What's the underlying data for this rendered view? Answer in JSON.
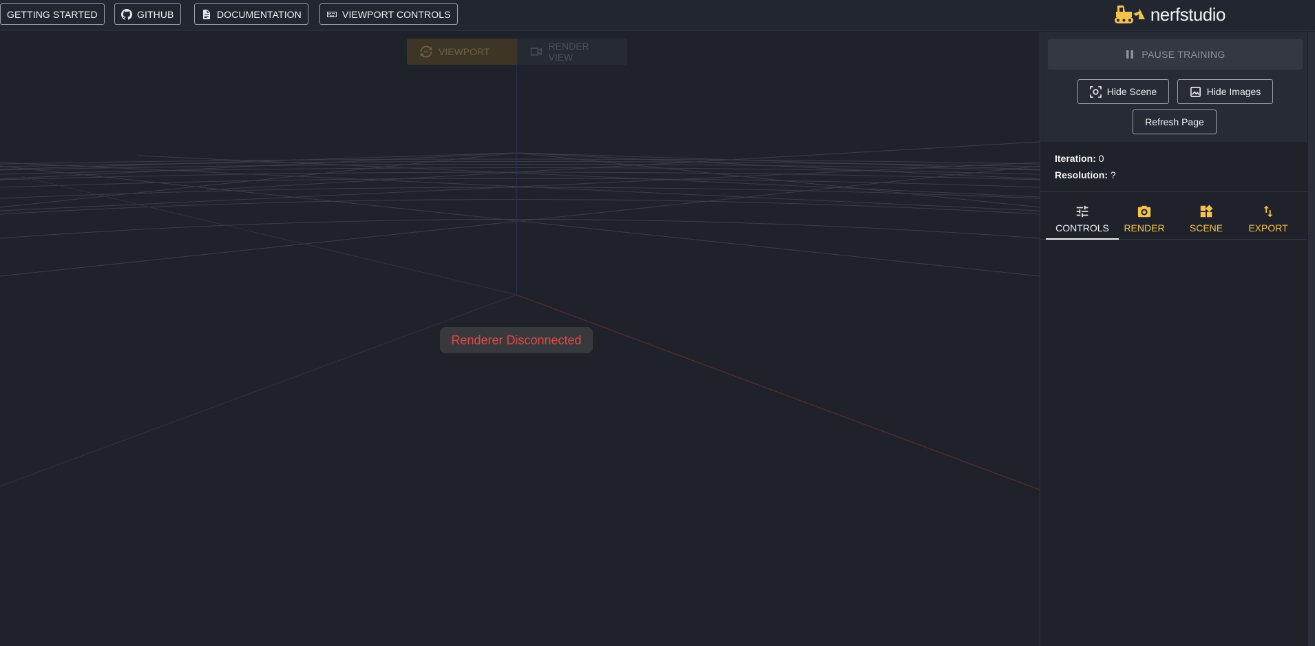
{
  "topbar": {
    "buttons": [
      {
        "label": "GETTING STARTED",
        "icon": "none"
      },
      {
        "label": "GITHUB",
        "icon": "github-icon"
      },
      {
        "label": "DOCUMENTATION",
        "icon": "document-icon"
      },
      {
        "label": "VIEWPORT CONTROLS",
        "icon": "keyboard-icon"
      }
    ],
    "logo_text": "nerfstudio",
    "logo_icon": "bulldozer-icon"
  },
  "viewport": {
    "toggle": {
      "viewport_label": "VIEWPORT",
      "render_view_label": "RENDER VIEW"
    },
    "status": "Renderer Disconnected"
  },
  "panel": {
    "pause_label": "PAUSE TRAINING",
    "hide_scene_label": "Hide Scene",
    "hide_images_label": "Hide Images",
    "refresh_label": "Refresh Page",
    "stats": {
      "iteration_label": "Iteration:",
      "iteration_value": "0",
      "resolution_label": "Resolution:",
      "resolution_value": "?"
    },
    "tabs": [
      {
        "label": "CONTROLS",
        "icon": "sliders-icon",
        "active": true
      },
      {
        "label": "RENDER",
        "icon": "camera-icon",
        "active": false
      },
      {
        "label": "SCENE",
        "icon": "widgets-icon",
        "active": false
      },
      {
        "label": "EXPORT",
        "icon": "swap-vert-icon",
        "active": false
      }
    ]
  },
  "colors": {
    "accent": "#f5c34d",
    "background": "#1f222a",
    "error": "#e04848"
  }
}
